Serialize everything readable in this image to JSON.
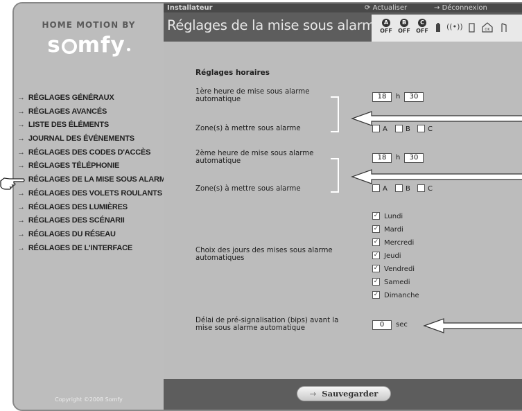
{
  "brand": {
    "tagline": "HOME MOTION BY",
    "name": "somfy",
    "copyright": "Copyright ©2008 Somfy"
  },
  "header": {
    "user": "Installateur",
    "refresh_label": "Actualiser",
    "logout_label": "Déconnexion",
    "title": "Réglages de la mise sous alarme",
    "zones": [
      {
        "letter": "A",
        "state": "OFF"
      },
      {
        "letter": "B",
        "state": "OFF"
      },
      {
        "letter": "C",
        "state": "OFF"
      }
    ]
  },
  "sidebar": {
    "items": [
      {
        "label": "RÉGLAGES GÉNÉRAUX"
      },
      {
        "label": "RÉGLAGES AVANCÉS"
      },
      {
        "label": "LISTE DES ÉLÉMENTS"
      },
      {
        "label": "JOURNAL DES ÉVÉNEMENTS"
      },
      {
        "label": "RÉGLAGES DES CODES D'ACCÈS"
      },
      {
        "label": "RÉGLAGES TÉLÉPHONIE"
      },
      {
        "label": "RÉGLAGES DE LA MISE SOUS ALARME",
        "active": true
      },
      {
        "label": "RÉGLAGES DES VOLETS ROULANTS"
      },
      {
        "label": "RÉGLAGES DES LUMIÈRES"
      },
      {
        "label": "RÉGLAGES DES SCÉNARII"
      },
      {
        "label": "RÉGLAGES DU RÉSEAU"
      },
      {
        "label": "RÉGLAGES DE L'INTERFACE"
      }
    ]
  },
  "form": {
    "section_title": "Réglages horaires",
    "first": {
      "label_line1": "1ère heure de mise sous alarme",
      "label_line2": "automatique",
      "hours": "18",
      "minutes": "30",
      "zones_label": "Zone(s) à mettre sous alarme"
    },
    "second": {
      "label_line1": "2ème heure de mise sous alarme",
      "label_line2": "automatique",
      "hours": "18",
      "minutes": "30",
      "zones_label": "Zone(s) à mettre sous alarme"
    },
    "hour_unit": "h",
    "zone_options": [
      "A",
      "B",
      "C"
    ],
    "days_label_line1": "Choix des jours des mises sous alarme",
    "days_label_line2": "automatiques",
    "days": [
      {
        "label": "Lundi",
        "checked": true
      },
      {
        "label": "Mardi",
        "checked": true
      },
      {
        "label": "Mercredi",
        "checked": true
      },
      {
        "label": "Jeudi",
        "checked": true
      },
      {
        "label": "Vendredi",
        "checked": true
      },
      {
        "label": "Samedi",
        "checked": true
      },
      {
        "label": "Dimanche",
        "checked": true
      }
    ],
    "delay_label_line1": "Délai de pré-signalisation (bips) avant la",
    "delay_label_line2": "mise sous alarme automatique",
    "delay_value": "0",
    "delay_unit": "sec"
  },
  "footer": {
    "save_label": "Sauvegarder"
  }
}
